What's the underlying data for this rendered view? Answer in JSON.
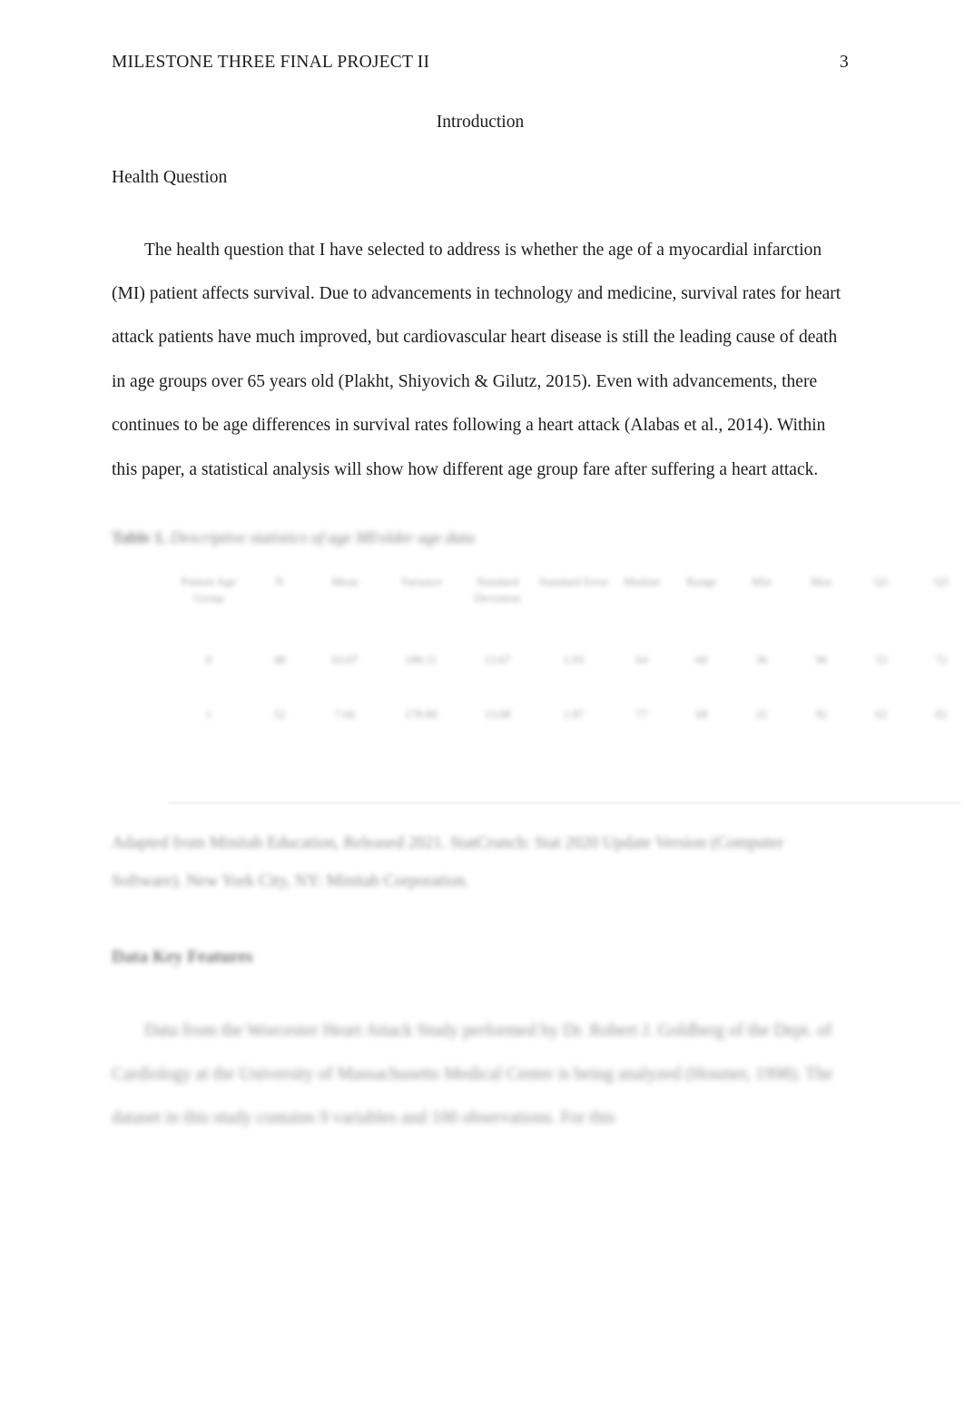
{
  "header": {
    "running_head": "MILESTONE THREE FINAL PROJECT II",
    "page_number": "3"
  },
  "title": "Introduction",
  "subheading": "Health Question",
  "body_paragraph": "The health question that I have selected to address is whether the age of a myocardial infarction (MI) patient affects survival. Due to advancements in technology and medicine, survival rates for heart attack patients have much improved, but cardiovascular heart disease is still the leading cause of death in age groups over 65 years old (Plakht, Shiyovich & Gilutz, 2015). Even with advancements, there continues to be age differences in survival rates following a heart attack (Alabas et al., 2014). Within this paper, a statistical analysis will show how different age group fare after suffering a heart attack.",
  "table": {
    "caption_label": "Table 1.",
    "caption_text": "Descriptive statistics of age MI/older age data",
    "columns": [
      "Patient Age Group",
      "N",
      "Mean",
      "Variance",
      "Standard Deviation",
      "Standard Error",
      "Median",
      "Range",
      "Min",
      "Max",
      "Q1",
      "Q3"
    ],
    "rows": [
      [
        "0",
        "48",
        "63.07",
        "188.11",
        "13.67",
        "1.93",
        "64",
        "60",
        "36",
        "96",
        "53",
        "72"
      ],
      [
        "1",
        "52",
        "7.66",
        "178.80",
        "13.08",
        "1.87",
        "77",
        "68",
        "32",
        "92",
        "62",
        "82"
      ]
    ],
    "note": "Adapted from Minitab Education, Released 2021. StatCrunch: Stat 2020 Update Version (Computer Software). New York City, NY: Minitab Corporation."
  },
  "lower_section": {
    "heading": "Data Key Features",
    "paragraph": "Data from the Worcester Heart Attack Study performed by Dr. Robert J. Goldberg of the Dept. of Cardiology at the University of Massachusetts Medical Center is being analyzed (Hosmer, 1998). The dataset in this study contains 9 variables and 100 observations. For this"
  }
}
